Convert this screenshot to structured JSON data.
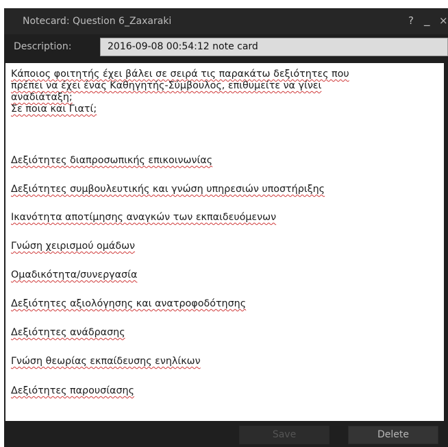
{
  "window": {
    "title": "Notecard: Question 6_Zaxaraki",
    "help_glyph": "?",
    "minimize_glyph": "_",
    "close_glyph": "×"
  },
  "description": {
    "label": "Description:",
    "value": "2016-09-08 00:54:12 note card"
  },
  "body": {
    "lines": [
      "Κάποιος φοιτητής έχει βάλει σε σειρά τις παρακάτω δεξιότητες που",
      "πρέπει να έχει ένας Καθηγητής-Σύμβουλος, επιθυμείτε να γίνει",
      "αναδιάταξη;",
      "Σε ποια και Γιατί;",
      "Δεξιότητες διαπροσωπικής επικοινωνίας",
      "Δεξιότητες συμβουλευτικής και γνώση υπηρεσιών υποστήριξης",
      "Ικανότητα αποτίμησης αναγκών των εκπαιδευόμενων",
      "Γνώση χειρισμού ομάδων",
      "Ομαδικότητα/συνεργασία",
      "Δεξιότητες αξιολόγησης και ανατροφοδότησης",
      "Δεξιότητες ανάδρασης",
      "Γνώση θεωρίας εκπαίδευσης ενηλίκων",
      "Δεξιότητες παρουσίασης"
    ]
  },
  "buttons": {
    "save_label": "Save",
    "delete_label": "Delete"
  }
}
